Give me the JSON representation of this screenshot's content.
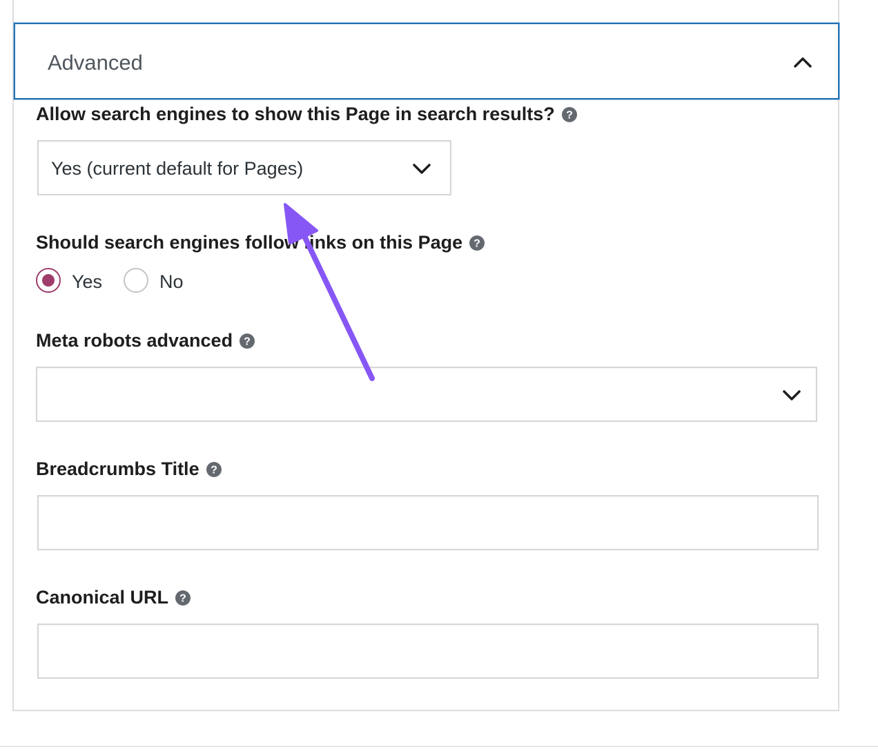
{
  "accordion": {
    "title": "Advanced",
    "expanded": true
  },
  "fields": {
    "search_visibility": {
      "label": "Allow search engines to show this Page in search results?",
      "selected": "Yes (current default for Pages)"
    },
    "follow_links": {
      "label": "Should search engines follow links on this Page",
      "options": [
        {
          "label": "Yes",
          "checked": true
        },
        {
          "label": "No",
          "checked": false
        }
      ]
    },
    "meta_robots": {
      "label": "Meta robots advanced",
      "selected": ""
    },
    "breadcrumbs_title": {
      "label": "Breadcrumbs Title",
      "value": ""
    },
    "canonical_url": {
      "label": "Canonical URL",
      "value": ""
    }
  },
  "icons": {
    "help": "question-circle-icon",
    "chevron_up": "chevron-up-icon",
    "chevron_down": "chevron-down-icon"
  },
  "colors": {
    "focus_border": "#2271b1",
    "radio_accent": "#9e3d6c",
    "annotation_arrow": "#8757f5"
  }
}
